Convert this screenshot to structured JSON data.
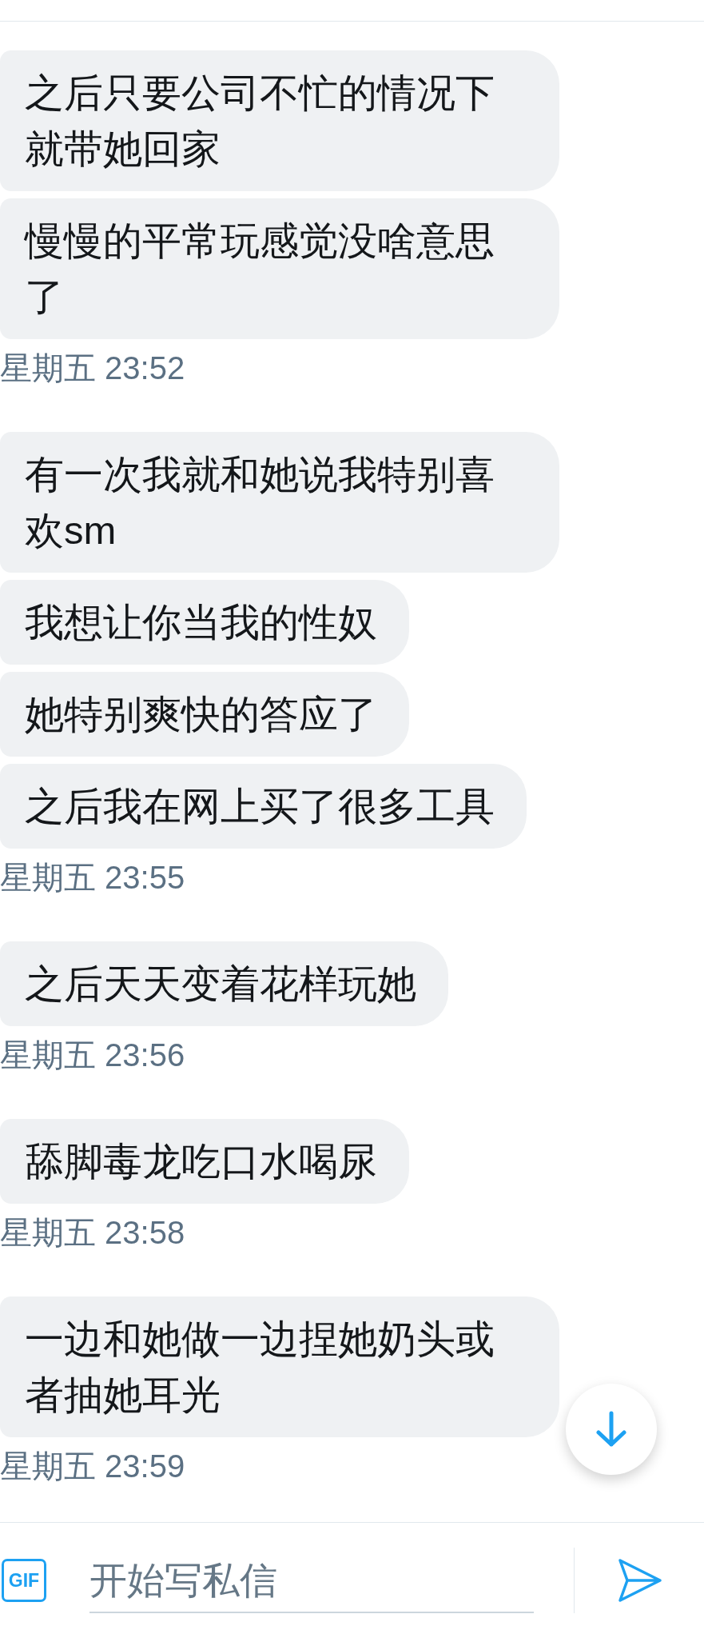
{
  "conversation": [
    {
      "messages": [
        "之后只要公司不忙的情况下就带她回家",
        "慢慢的平常玩感觉没啥意思了"
      ],
      "timestamp": "星期五 23:52"
    },
    {
      "messages": [
        "有一次我就和她说我特别喜欢sm",
        "我想让你当我的性奴",
        "她特别爽快的答应了",
        "之后我在网上买了很多工具"
      ],
      "timestamp": "星期五 23:55"
    },
    {
      "messages": [
        "之后天天变着花样玩她"
      ],
      "timestamp": "星期五 23:56"
    },
    {
      "messages": [
        "舔脚毒龙吃口水喝尿"
      ],
      "timestamp": "星期五 23:58"
    },
    {
      "messages": [
        "一边和她做一边捏她奶头或者抽她耳光"
      ],
      "timestamp": "星期五 23:59"
    }
  ],
  "composer": {
    "gif_label": "GIF",
    "placeholder": "开始写私信"
  }
}
